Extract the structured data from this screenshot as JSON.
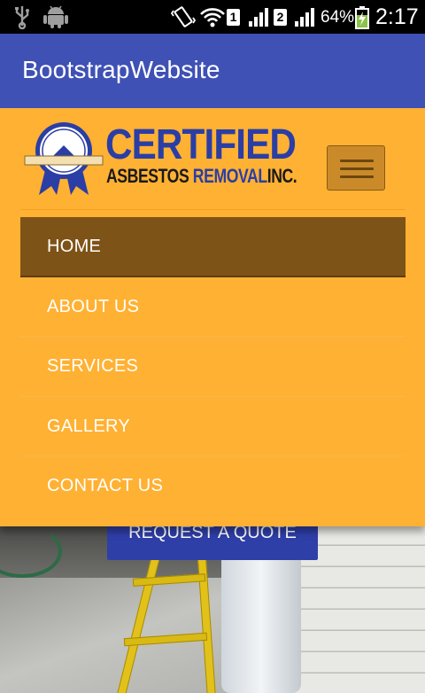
{
  "status_bar": {
    "sim1_label": "1",
    "sim2_label": "2",
    "battery_percent": "64%",
    "time": "2:17",
    "icons": [
      "usb-icon",
      "android-icon",
      "vibrate-icon",
      "wifi-icon",
      "signal-icon",
      "battery-charging-icon"
    ]
  },
  "app_bar": {
    "title": "BootstrapWebsite",
    "color": "#3f51b5"
  },
  "site": {
    "header_color": "#ffb133",
    "logo": {
      "line1": "CERTIFIED",
      "line2_part1": "ASBESTOS",
      "line2_part2": "REMOVAL",
      "line2_part3": "INC.",
      "seal_arc_text": "CERTIFIED ASBESTOS REMOVAL",
      "seal_ribbon_text": "SATISFACTION GUARANTEED"
    },
    "nav": {
      "items": [
        {
          "label": "HOME",
          "active": true
        },
        {
          "label": "ABOUT US",
          "active": false
        },
        {
          "label": "SERVICES",
          "active": false
        },
        {
          "label": "GALLERY",
          "active": false
        },
        {
          "label": "CONTACT US",
          "active": false
        }
      ]
    },
    "cta": {
      "label": "REQUEST A QUOTE",
      "color": "#2f3fa8"
    }
  }
}
